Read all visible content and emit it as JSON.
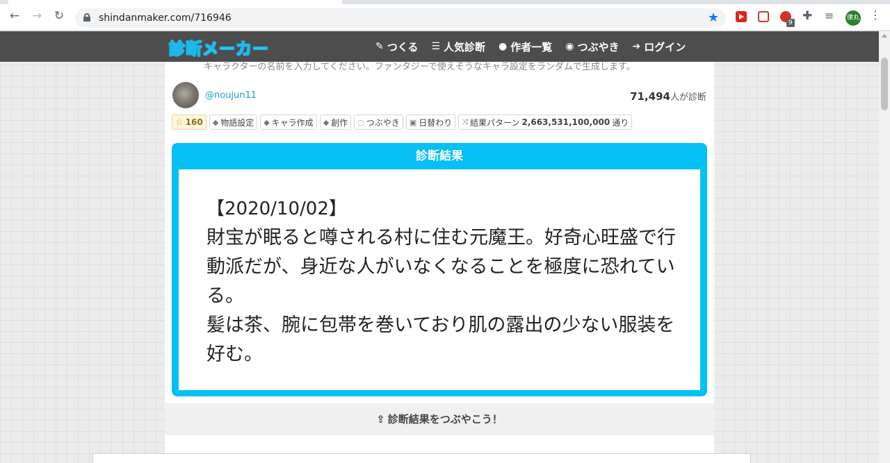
{
  "browser": {
    "url": "shindanmaker.com/716946",
    "extension_badge": "9",
    "profile_label": "律丸"
  },
  "header": {
    "logo": "診断メーカー",
    "nav": [
      {
        "label": "つくる",
        "icon": "edit-icon"
      },
      {
        "label": "人気診断",
        "icon": "list-icon"
      },
      {
        "label": "作者一覧",
        "icon": "user-icon"
      },
      {
        "label": "つぶやき",
        "icon": "comments-icon"
      },
      {
        "label": "ログイン",
        "icon": "login-icon"
      }
    ]
  },
  "shindan": {
    "intro_text": "キャラクターの名前を入力してください。ファンタジーで使えそうなキャラ設定をランダムで生成します。",
    "author": "@noujun11",
    "count_number": "71,494",
    "count_suffix": "人が診断",
    "tags": {
      "favorites": "160",
      "tag1": "物語設定",
      "tag2": "キャラ作成",
      "tag3": "創作",
      "tweets": "つぶやき",
      "daily": "日替わり",
      "pattern_prefix": "結果パターン",
      "pattern_number": "2,663,531,100,000",
      "pattern_suffix": "通り"
    },
    "result_title": "診断結果",
    "result_date": "【2020/10/02】",
    "result_body": "財宝が眠ると噂される村に住む元魔王。好奇心旺盛で行動派だが、身近な人がいなくなることを極度に恐れている。\n髪は茶、腕に包帯を巻いており肌の露出の少ない服装を好む。",
    "share_label": "診断結果をつぶやこう！"
  },
  "colors": {
    "accent": "#04c0f5",
    "header_bg": "#4d4d4d",
    "author_link": "#1a9bd7"
  }
}
